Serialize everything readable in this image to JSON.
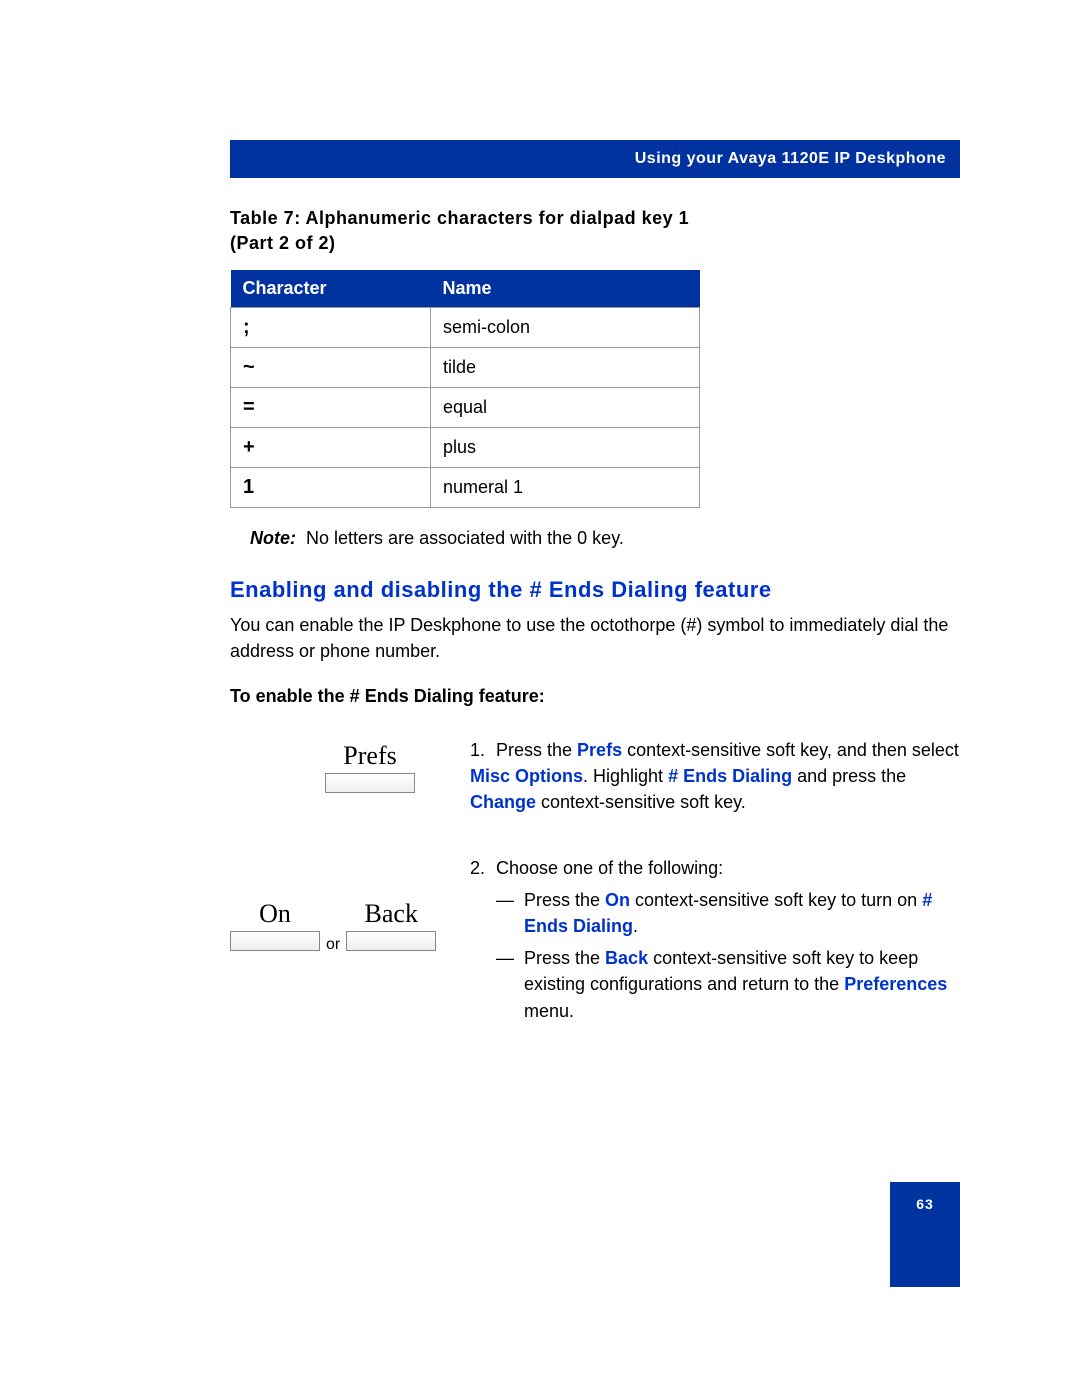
{
  "header": "Using your Avaya 1120E IP Deskphone",
  "table_caption_l1": "Table 7: Alphanumeric characters for dialpad key 1",
  "table_caption_l2": "(Part 2 of 2)",
  "th_character": "Character",
  "th_name": "Name",
  "rows": [
    {
      "char": ";",
      "name": "semi-colon"
    },
    {
      "char": "~",
      "name": "tilde"
    },
    {
      "char": "=",
      "name": "equal"
    },
    {
      "char": "+",
      "name": "plus"
    },
    {
      "char": "1",
      "name": "numeral 1"
    }
  ],
  "note_label": "Note:",
  "note_text": "No letters are associated with the 0 key.",
  "section_heading": "Enabling and disabling the # Ends Dialing feature",
  "intro_text": "You can enable the IP Deskphone to use the octothorpe (#) symbol to immediately dial the address or phone number.",
  "sub_heading": "To enable the # Ends Dialing feature:",
  "softkeys": {
    "prefs": "Prefs",
    "on": "On",
    "back": "Back",
    "or": "or"
  },
  "step1": {
    "num": "1.",
    "t1": "Press the ",
    "hl_prefs": "Prefs",
    "t2": " context-sensitive soft key, and then select ",
    "hl_misc": "Misc Options",
    "t3": ". Highlight ",
    "hl_ends": "# Ends Dialing",
    "t4": " and press the ",
    "hl_change": "Change",
    "t5": " context-sensitive soft key."
  },
  "step2": {
    "num": "2.",
    "intro": "Choose one of the following:",
    "a": {
      "dash": "—",
      "t1": "Press the ",
      "hl_on": "On",
      "t2": " context-sensitive soft key to turn on ",
      "hl_ends": "# Ends Dialing",
      "t3": "."
    },
    "b": {
      "dash": "—",
      "t1": "Press the ",
      "hl_back": "Back",
      "t2": " context-sensitive soft key to keep existing configurations and return to the ",
      "hl_pref": "Preferences",
      "t3": " menu."
    }
  },
  "page_number": "63"
}
